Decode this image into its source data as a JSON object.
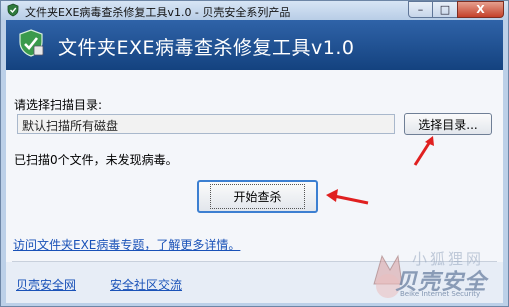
{
  "window": {
    "title": "文件夹EXE病毒查杀修复工具v1.0 - 贝壳安全系列产品",
    "controls": {
      "minimize": "–",
      "maximize": "□",
      "close": "X"
    }
  },
  "header": {
    "title": "文件夹EXE病毒查杀修复工具v1.0"
  },
  "scan": {
    "dir_label": "请选择扫描目录:",
    "dir_value": "默认扫描所有磁盘",
    "browse_label": "选择目录...",
    "status": "已扫描0个文件，未发现病毒。",
    "start_label": "开始查杀"
  },
  "links": {
    "topic": "访问文件夹EXE病毒专题，了解更多详情。",
    "site": "贝壳安全网",
    "community": "安全社区交流"
  },
  "watermark": {
    "small": "小狐狸网",
    "brand": "贝壳安全",
    "en": "Beike Internet Security"
  },
  "colors": {
    "header_bg": "#1e4f92",
    "link": "#1a52b8",
    "annotation_arrow": "#e02020"
  }
}
